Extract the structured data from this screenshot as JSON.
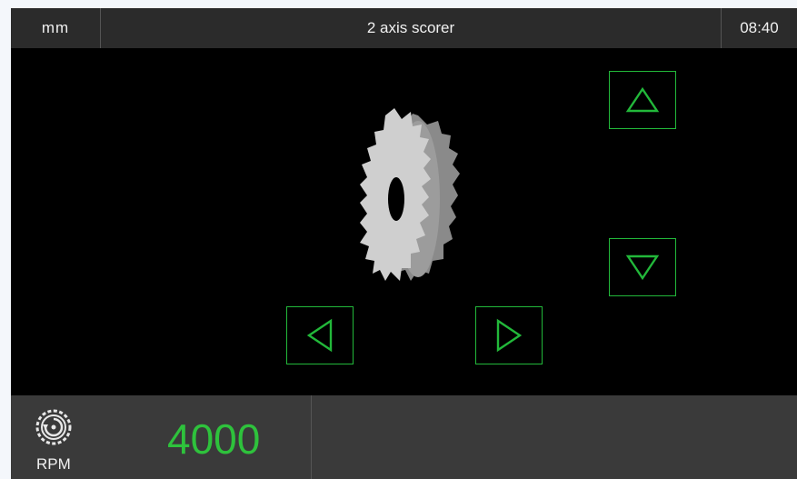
{
  "header": {
    "units": "mm",
    "title": "2 axis scorer",
    "time": "08:40"
  },
  "controls": {
    "up_icon": "triangle-up-icon",
    "down_icon": "triangle-down-icon",
    "left_icon": "triangle-left-icon",
    "right_icon": "triangle-right-icon",
    "accent_color": "#22b83a"
  },
  "status": {
    "rpm_icon": "saw-rpm-icon",
    "rpm_label": "RPM",
    "rpm_value": "4000",
    "value_color": "#2ec23c"
  },
  "illustration": {
    "icon": "scorer-blade-illustration"
  }
}
